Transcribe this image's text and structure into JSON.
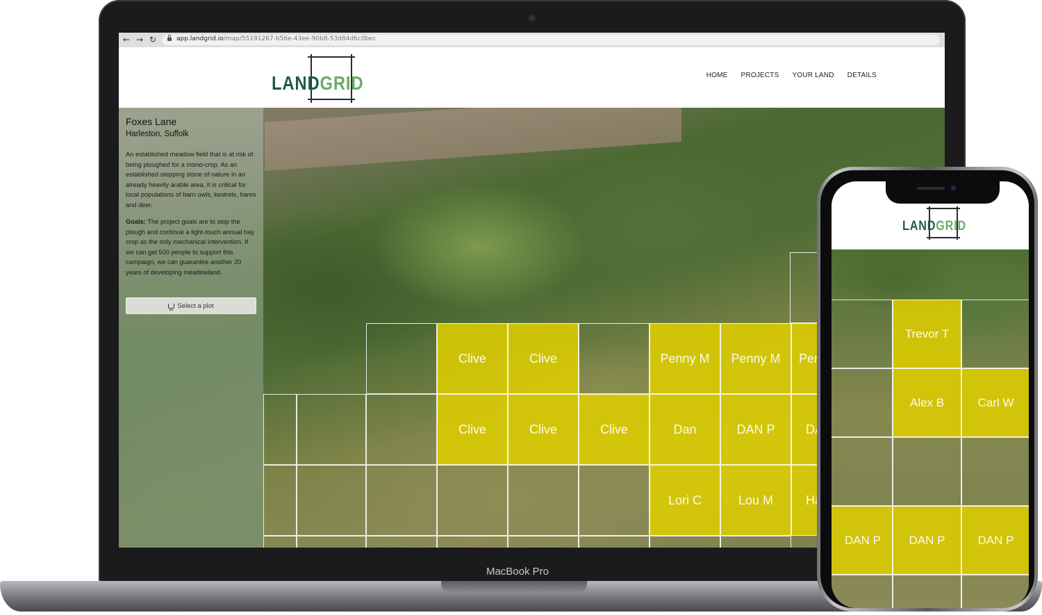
{
  "browser": {
    "back": "←",
    "forward": "→",
    "reload": "↻",
    "url_host": "app.landgrid.io",
    "url_path": "/map/55191267-b56e-43ee-90b8-53d84d6c0bec"
  },
  "brand": {
    "logo_land": "LAND",
    "logo_grid": "GRID",
    "laptop_label": "MacBook Pro"
  },
  "nav": [
    "HOME",
    "PROJECTS",
    "YOUR LAND",
    "DETAILS"
  ],
  "project": {
    "title": "Foxes Lane",
    "location": "Harleston, Suffolk",
    "description": "An established meadow field that is at risk of being ploughed for a mono-crop. As an established stepping stone of nature in an already heavily arable area, it is critical for local populations of barn owls, kestrels, hares and deer.",
    "goals_label": "Goals:",
    "goals_text": " The project goals are to stop the plough and continue a light-touch annual hay crop as the only mechanical intervention. If we can get 500 people to support this campaign, we can guarantee another 20 years of developing meadowland.",
    "select_plot": "Select a plot"
  },
  "laptop_plots": [
    {
      "label": "Clive",
      "taken": true
    },
    {
      "label": "Clive",
      "taken": true
    },
    {
      "label": "Penny M",
      "taken": true
    },
    {
      "label": "Penny M",
      "taken": true
    },
    {
      "label": "Pen",
      "taken": true
    },
    {
      "label": "Clive",
      "taken": true
    },
    {
      "label": "Clive",
      "taken": true
    },
    {
      "label": "Clive",
      "taken": true
    },
    {
      "label": "Dan",
      "taken": true
    },
    {
      "label": "DAN P",
      "taken": true
    },
    {
      "label": "DA",
      "taken": true
    },
    {
      "label": "Lori C",
      "taken": true
    },
    {
      "label": "Lou M",
      "taken": true
    },
    {
      "label": "Ha",
      "taken": true
    }
  ],
  "phone_plots": [
    {
      "label": "Trevor T",
      "taken": true
    },
    {
      "label": "Alex B",
      "taken": true
    },
    {
      "label": "Carl W",
      "taken": true
    },
    {
      "label": "DAN P",
      "taken": true
    },
    {
      "label": "DAN P",
      "taken": true
    },
    {
      "label": "DAN P",
      "taken": true
    }
  ],
  "colors": {
    "plot_taken": "#DDCD00",
    "logo_land": "#1F5A4A",
    "logo_grid": "#6AAB6A"
  }
}
